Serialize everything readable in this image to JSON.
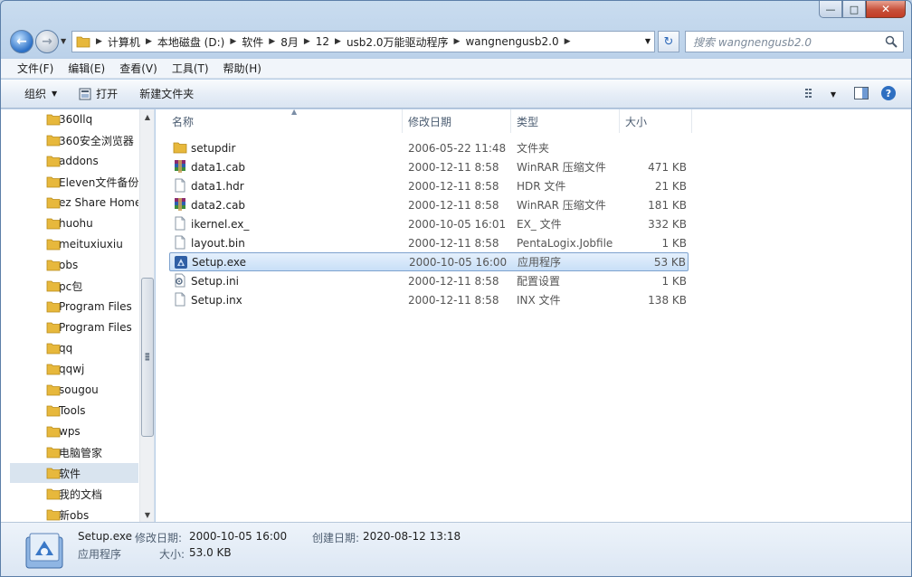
{
  "window": {
    "minimize_glyph": "—",
    "maximize_glyph": "□",
    "close_glyph": "✕"
  },
  "address": {
    "crumbs": [
      "计算机",
      "本地磁盘 (D:)",
      "软件",
      "8月",
      "12",
      "usb2.0万能驱动程序",
      "wangnengusb2.0"
    ],
    "search_placeholder": "搜索 wangnengusb2.0"
  },
  "menu": [
    "文件(F)",
    "编辑(E)",
    "查看(V)",
    "工具(T)",
    "帮助(H)"
  ],
  "toolbar": {
    "organize": "组织",
    "open": "打开",
    "new_folder": "新建文件夹"
  },
  "nav_tree": [
    "360llq",
    "360安全浏览器",
    "addons",
    "Eleven文件备份",
    "ez Share Home",
    "huohu",
    "meituxiuxiu",
    "obs",
    "pc包",
    "Program Files",
    "Program Files",
    "qq",
    "qqwj",
    "sougou",
    "Tools",
    "wps",
    "电脑管家",
    "软件",
    "我的文档",
    "新obs"
  ],
  "nav_selected_index": 17,
  "columns": [
    "名称",
    "修改日期",
    "类型",
    "大小"
  ],
  "files": [
    {
      "name": "setupdir",
      "date": "2006-05-22 11:48",
      "type": "文件夹",
      "size": "",
      "icon": "folder"
    },
    {
      "name": "data1.cab",
      "date": "2000-12-11 8:58",
      "type": "WinRAR 压缩文件",
      "size": "471 KB",
      "icon": "winrar"
    },
    {
      "name": "data1.hdr",
      "date": "2000-12-11 8:58",
      "type": "HDR 文件",
      "size": "21 KB",
      "icon": "file"
    },
    {
      "name": "data2.cab",
      "date": "2000-12-11 8:58",
      "type": "WinRAR 压缩文件",
      "size": "181 KB",
      "icon": "winrar"
    },
    {
      "name": "ikernel.ex_",
      "date": "2000-10-05 16:01",
      "type": "EX_ 文件",
      "size": "332 KB",
      "icon": "file"
    },
    {
      "name": "layout.bin",
      "date": "2000-12-11 8:58",
      "type": "PentaLogix.Jobfile",
      "size": "1 KB",
      "icon": "file"
    },
    {
      "name": "Setup.exe",
      "date": "2000-10-05 16:00",
      "type": "应用程序",
      "size": "53 KB",
      "icon": "setup"
    },
    {
      "name": "Setup.ini",
      "date": "2000-12-11 8:58",
      "type": "配置设置",
      "size": "1 KB",
      "icon": "ini"
    },
    {
      "name": "Setup.inx",
      "date": "2000-12-11 8:58",
      "type": "INX 文件",
      "size": "138 KB",
      "icon": "file"
    }
  ],
  "selected_file_index": 6,
  "details": {
    "name": "Setup.exe",
    "modified_label": "修改日期:",
    "modified_value": "2000-10-05 16:00",
    "created_label": "创建日期:",
    "created_value": "2020-08-12 13:18",
    "type": "应用程序",
    "size_label": "大小:",
    "size_value": "53.0 KB"
  },
  "colors": {
    "selection_bg": "#cce3f8",
    "selection_border": "#7da2ce",
    "folder": "#e7b83c"
  }
}
